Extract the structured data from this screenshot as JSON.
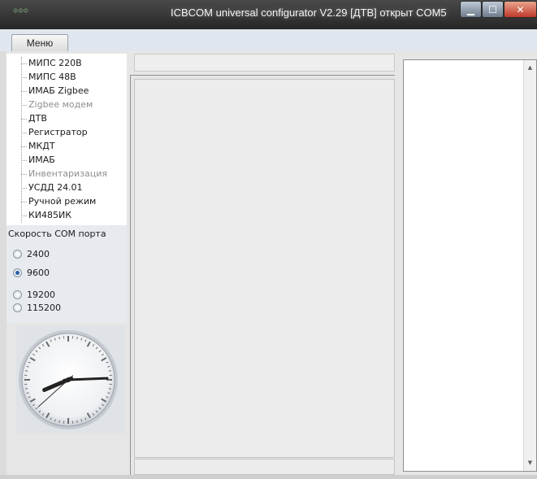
{
  "window": {
    "title": "ICBCOM universal configurator V2.29 [ДТВ] открыт COM5",
    "icon_name": "app-icon",
    "app_icon_text": "ΦΦΦ",
    "controls": {
      "minimize": "minimize-icon",
      "maximize": "maximize-icon",
      "close": "close-icon"
    }
  },
  "menubar": {
    "menu_label": "Меню"
  },
  "tree": {
    "items": [
      {
        "label": "МИПС 220В",
        "enabled": true
      },
      {
        "label": "МИПС 48В",
        "enabled": true
      },
      {
        "label": "ИМАБ Zigbee",
        "enabled": true
      },
      {
        "label": "Zigbee модем",
        "enabled": false
      },
      {
        "label": "ДТВ",
        "enabled": true
      },
      {
        "label": "Регистратор",
        "enabled": true
      },
      {
        "label": "МКДТ",
        "enabled": true
      },
      {
        "label": "ИМАБ",
        "enabled": true
      },
      {
        "label": "Инвентаризация",
        "enabled": false
      },
      {
        "label": "УСДД 24.01",
        "enabled": true
      },
      {
        "label": "Ручной режим",
        "enabled": true
      },
      {
        "label": "КИ485ИК",
        "enabled": true
      }
    ]
  },
  "baud": {
    "title": "Скорость COM порта",
    "options": [
      "2400",
      "9600",
      "19200",
      "115200"
    ],
    "selected": "9600"
  },
  "clock": {
    "hour": 8,
    "minute": 14,
    "second": 38
  },
  "colors": {
    "accent": "#2a5fa8",
    "close_button": "#c0392b"
  }
}
